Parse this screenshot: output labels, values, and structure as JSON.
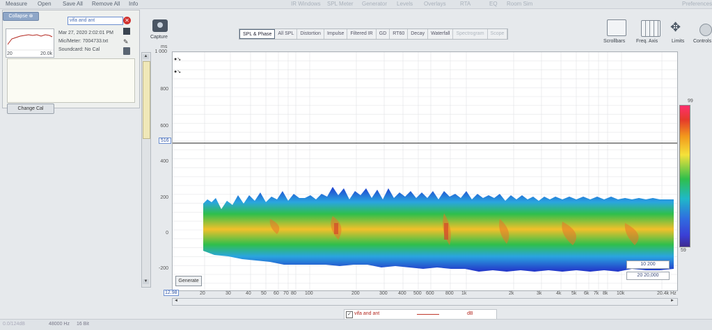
{
  "menu": {
    "left": [
      "Measure",
      "Open",
      "Save All",
      "Remove All",
      "Info"
    ],
    "center": [
      "IR Windows",
      "SPL Meter",
      "Generator",
      "Levels",
      "Overlays",
      "RTA",
      "EQ",
      "Room Sim"
    ],
    "right": "Preferences"
  },
  "panel": {
    "collapse_label": "Collapse",
    "name_value": "vifa and ant",
    "date": "Mar 27, 2020 2:02:01 PM",
    "mic": "Mic/Meter: 7004733.txt",
    "soundcard": "Soundcard: No Cal",
    "thumb_left": "20",
    "thumb_right": "20.0k",
    "change_cal": "Change Cal"
  },
  "capture_label": "Capture",
  "tabs": [
    {
      "label": "SPL & Phase",
      "state": "active"
    },
    {
      "label": "All SPL",
      "state": "normal"
    },
    {
      "label": "Distortion",
      "state": "normal"
    },
    {
      "label": "Impulse",
      "state": "normal"
    },
    {
      "label": "Filtered IR",
      "state": "normal"
    },
    {
      "label": "GD",
      "state": "normal"
    },
    {
      "label": "RT60",
      "state": "normal"
    },
    {
      "label": "Decay",
      "state": "normal"
    },
    {
      "label": "Waterfall",
      "state": "normal"
    },
    {
      "label": "Spectrogram",
      "state": "off"
    },
    {
      "label": "Scope",
      "state": "off"
    }
  ],
  "tools": [
    "Scrollbars",
    "Freq. Axis",
    "Limits",
    "Controls"
  ],
  "plot": {
    "y_unit": "ms",
    "y_ticks": [
      "1 000",
      "800",
      "600",
      "400",
      "200",
      "0",
      "-200"
    ],
    "cursor_value": "516",
    "x_ticks": [
      "20",
      "30",
      "40",
      "50",
      "60",
      "70",
      "80",
      "100",
      "200",
      "300",
      "400",
      "500",
      "600",
      "800",
      "1k",
      "2k",
      "3k",
      "4k",
      "5k",
      "6k",
      "7k",
      "8k",
      "10k",
      "20.4k Hz"
    ],
    "x_cursor": "12.98",
    "generate_label": "Generate",
    "colorbar_max": "99",
    "colorbar_min": "59",
    "range_1": "10   200",
    "range_2": "20   20,000"
  },
  "legend": {
    "name": "vifa and ant",
    "unit": "dB"
  },
  "status": {
    "left": "0.0/124dB",
    "rate": "48000 Hz",
    "bits": "16 Bit"
  },
  "colors": {
    "accent": "#4a6fb5",
    "close": "#d0312d",
    "collapse": "#8fa7c8"
  }
}
